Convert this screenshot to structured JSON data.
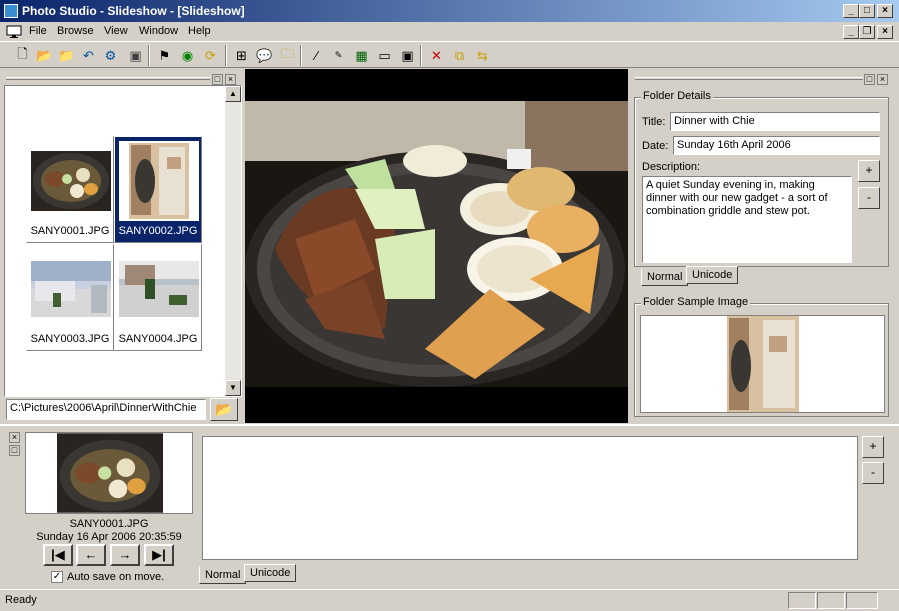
{
  "window": {
    "title": "Photo Studio - Slideshow - [Slideshow]"
  },
  "menu": {
    "items": [
      "File",
      "Browse",
      "View",
      "Window",
      "Help"
    ]
  },
  "browser": {
    "thumbnails": [
      {
        "label": "SANY0001.JPG"
      },
      {
        "label": "SANY0002.JPG",
        "selected": true
      },
      {
        "label": "SANY0003.JPG"
      },
      {
        "label": "SANY0004.JPG"
      }
    ],
    "path": "C:\\Pictures\\2006\\April\\DinnerWithChie"
  },
  "details": {
    "group_title": "Folder Details",
    "title_label": "Title:",
    "title_value": "Dinner with Chie",
    "date_label": "Date:",
    "date_value": "Sunday 16th April 2006",
    "description_label": "Description:",
    "description_value": "A quiet Sunday evening in, making dinner with our new gadget - a sort of combination griddle and stew pot.",
    "tabs": [
      "Normal",
      "Unicode"
    ],
    "plus": "+",
    "minus": "-"
  },
  "sample": {
    "group_title": "Folder Sample Image"
  },
  "bottom": {
    "filename": "SANY0001.JPG",
    "datetime": "Sunday 16 Apr 2006 20:35:59",
    "autosave_label": "Auto save on move.",
    "tabs": [
      "Normal",
      "Unicode"
    ],
    "plus": "+",
    "minus": "-"
  },
  "status": {
    "text": "Ready"
  },
  "colors": {
    "titlebar": "#0a246a",
    "selection": "#0a246a",
    "face": "#d4d0c8"
  }
}
